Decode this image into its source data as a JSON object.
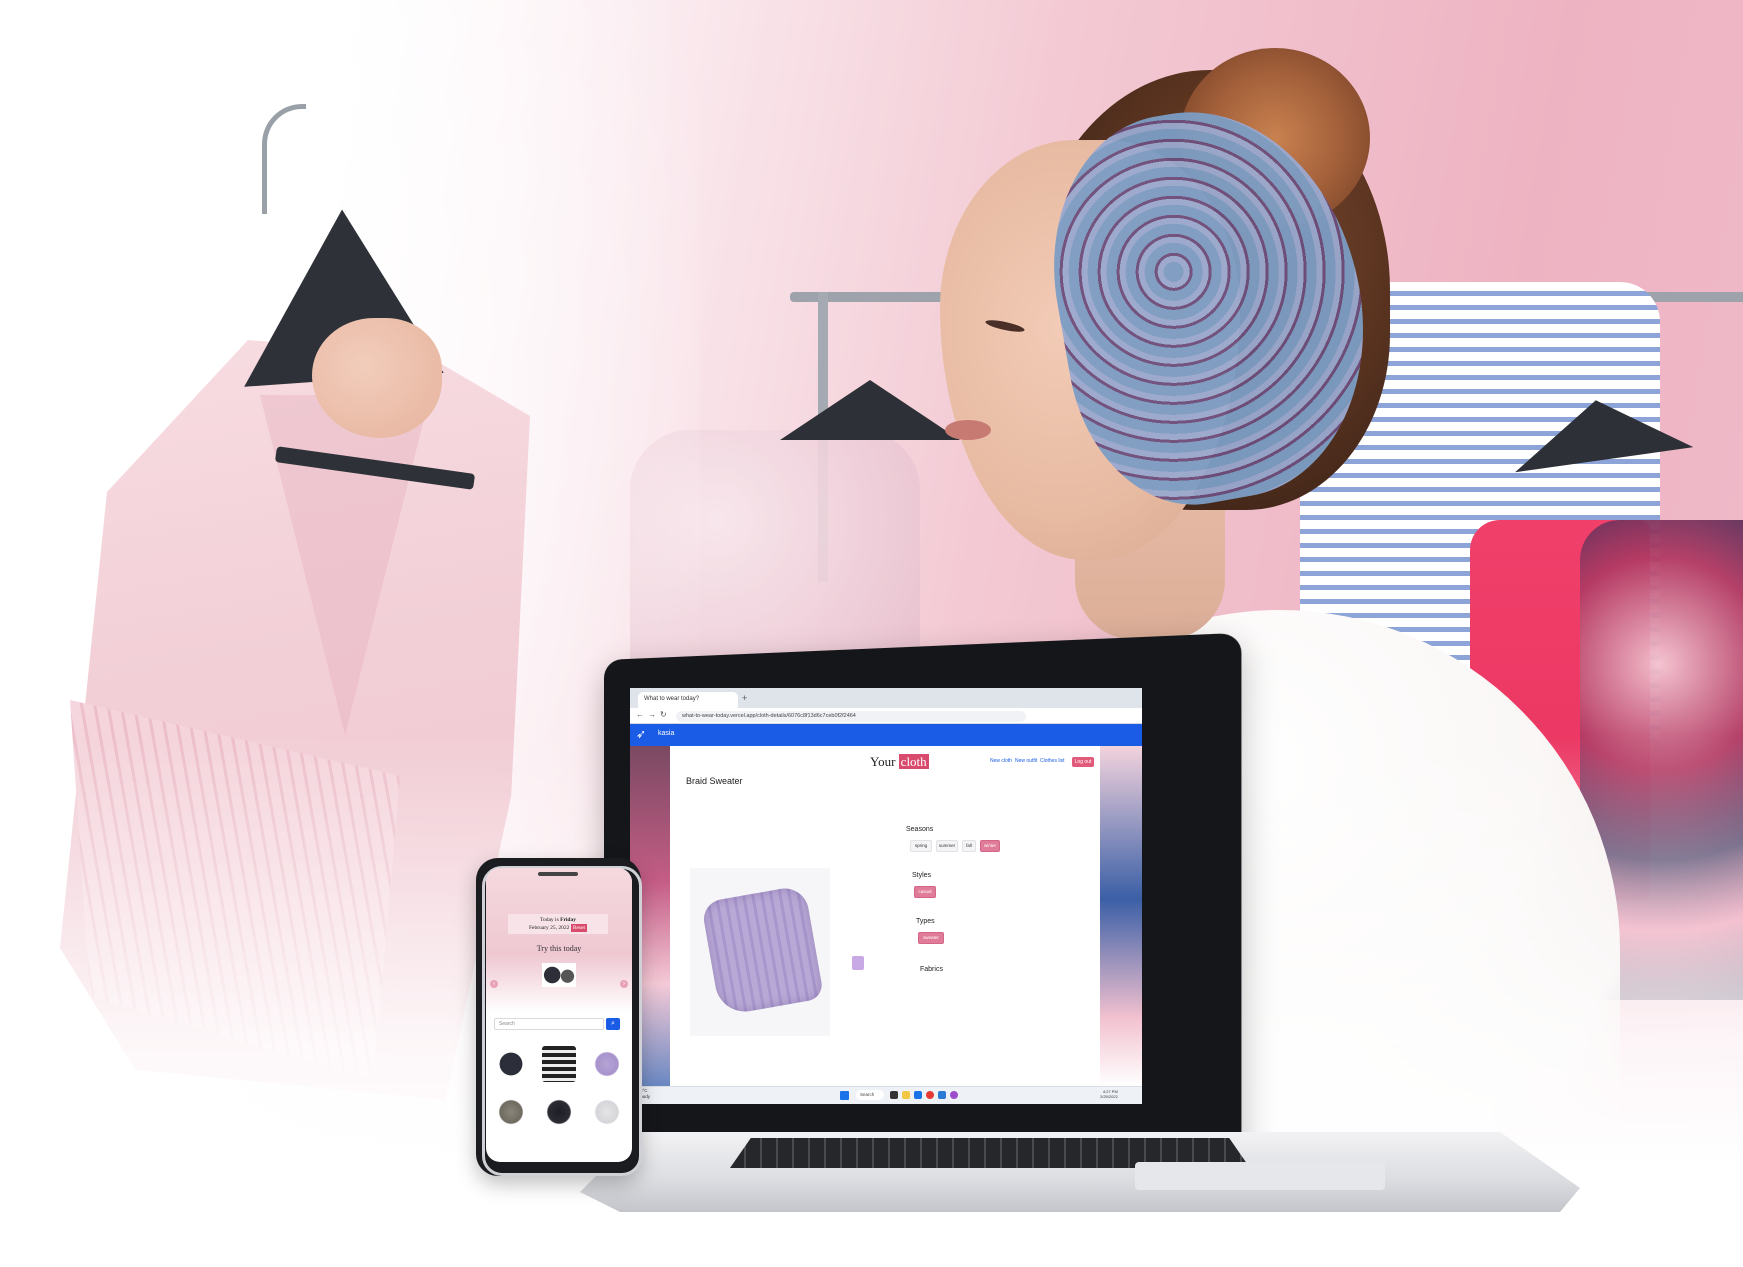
{
  "laptop": {
    "browser": {
      "tab_title": "What to wear today?",
      "new_tab_glyph": "+",
      "url": "what-to-wear-today.vercel.app/cloth-details/6076c8f13d6c7ceb0f2f2464"
    },
    "site": {
      "user_name": "kasia",
      "brand_prefix": "Your",
      "brand_accent": "cloth",
      "menu": [
        "New cloth",
        "New outfit",
        "Clothes list"
      ],
      "login_label": "Log out",
      "colors": {
        "header": "#1a5ce6",
        "accent": "#d94b6c"
      }
    },
    "item": {
      "title": "Braid Sweater",
      "image_icon": "sweater-icon",
      "swatch_color": "#c9a8e6",
      "seasons_label": "Seasons",
      "seasons": [
        {
          "label": "spring",
          "selected": false
        },
        {
          "label": "summer",
          "selected": false
        },
        {
          "label": "fall",
          "selected": false
        },
        {
          "label": "winter",
          "selected": true
        }
      ],
      "styles_label": "Styles",
      "styles": [
        {
          "label": "casual",
          "selected": true
        }
      ],
      "types_label": "Types",
      "types": [
        {
          "label": "sweater",
          "selected": true
        }
      ],
      "fabrics_label": "Fabrics"
    },
    "taskbar": {
      "weather_temp": "-15°C",
      "weather_desc": "Cloudy",
      "search_label": "Search",
      "clock_time": "4:27 PM",
      "clock_date": "2/25/2022"
    }
  },
  "phone": {
    "today_prefix": "Today is",
    "today_day": "Friday",
    "today_date": "February 25, 2022",
    "today_button": "Reset",
    "try_label": "Try this today",
    "search_placeholder": "Search",
    "prev_glyph": "‹",
    "next_glyph": "›",
    "search_icon": "search-icon"
  }
}
